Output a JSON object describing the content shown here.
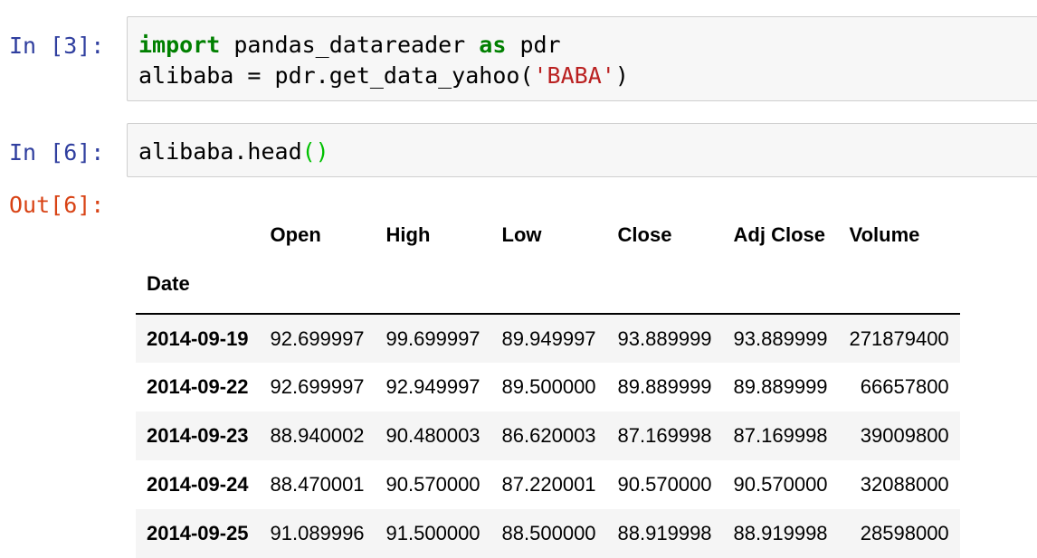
{
  "cells": [
    {
      "prompt": "In [3]:",
      "lines": [
        [
          {
            "t": "import",
            "c": "kw"
          },
          {
            "t": " pandas_datareader ",
            "c": ""
          },
          {
            "t": "as",
            "c": "kw"
          },
          {
            "t": " pdr",
            "c": ""
          }
        ],
        [
          {
            "t": "alibaba = pdr.get_data_yahoo(",
            "c": ""
          },
          {
            "t": "'BABA'",
            "c": "str"
          },
          {
            "t": ")",
            "c": ""
          }
        ]
      ]
    },
    {
      "prompt": "In [6]:",
      "lines": [
        [
          {
            "t": "alibaba.head",
            "c": ""
          },
          {
            "t": "()",
            "c": "paren"
          }
        ]
      ]
    }
  ],
  "output": {
    "prompt": "Out[6]:",
    "index_name": "Date",
    "columns": [
      "Open",
      "High",
      "Low",
      "Close",
      "Adj Close",
      "Volume"
    ],
    "rows": [
      {
        "date": "2014-09-19",
        "values": [
          "92.699997",
          "99.699997",
          "89.949997",
          "93.889999",
          "93.889999",
          "271879400"
        ]
      },
      {
        "date": "2014-09-22",
        "values": [
          "92.699997",
          "92.949997",
          "89.500000",
          "89.889999",
          "89.889999",
          "66657800"
        ]
      },
      {
        "date": "2014-09-23",
        "values": [
          "88.940002",
          "90.480003",
          "86.620003",
          "87.169998",
          "87.169998",
          "39009800"
        ]
      },
      {
        "date": "2014-09-24",
        "values": [
          "88.470001",
          "90.570000",
          "87.220001",
          "90.570000",
          "90.570000",
          "32088000"
        ]
      },
      {
        "date": "2014-09-25",
        "values": [
          "91.089996",
          "91.500000",
          "88.500000",
          "88.919998",
          "88.919998",
          "28598000"
        ]
      }
    ]
  }
}
